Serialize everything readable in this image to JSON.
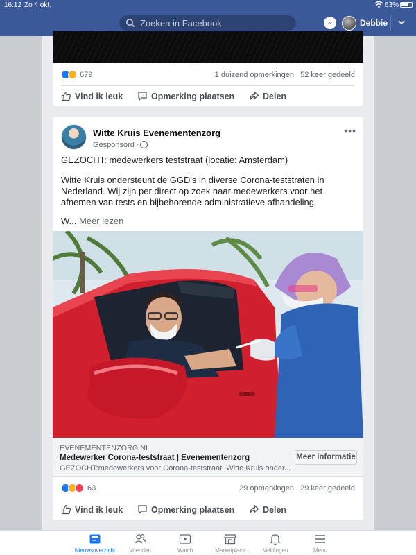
{
  "status_bar": {
    "time": "16:12",
    "date": "Zo 4 okt.",
    "battery": "63%"
  },
  "header": {
    "search_placeholder": "Zoeken in Facebook",
    "user_name": "Debbie"
  },
  "post_previous": {
    "reaction_count": "679",
    "comments": "1 duizend opmerkingen",
    "shares": "52 keer gedeeld",
    "actions": {
      "like": "Vind ik leuk",
      "comment": "Opmerking plaatsen",
      "share": "Delen"
    }
  },
  "post_ad": {
    "page_name": "Witte Kruis Evenementenzorg",
    "sponsored": "Gesponsord",
    "separator": "·",
    "headline": "GEZOCHT: medewerkers teststraat (locatie: Amsterdam)",
    "body": "Witte Kruis ondersteunt de GGD's in diverse Corona-teststraten in Nederland. Wij zijn per direct op zoek naar medewerkers voor het afnemen van tests en bijbehorende administratieve afhandeling.",
    "truncated": "W...",
    "read_more": "Meer lezen",
    "link": {
      "domain": "EVENEMENTENZORG.NL",
      "title": "Medewerker Corona-teststraat | Evenementenzorg",
      "description": "GEZOCHT:medewerkers voor Corona-teststraat. Witte Kruis onder...",
      "cta": "Meer informatie"
    },
    "reaction_count": "63",
    "comments": "29 opmerkingen",
    "shares": "29 keer gedeeld",
    "actions": {
      "like": "Vind ik leuk",
      "comment": "Opmerking plaatsen",
      "share": "Delen"
    }
  },
  "tabs": [
    {
      "label": "Nieuwsoverzicht",
      "icon": "news-feed-icon",
      "active": true
    },
    {
      "label": "Vrienden",
      "icon": "friends-icon",
      "active": false
    },
    {
      "label": "Watch",
      "icon": "watch-icon",
      "active": false
    },
    {
      "label": "Marketplace",
      "icon": "marketplace-icon",
      "active": false
    },
    {
      "label": "Meldingen",
      "icon": "bell-icon",
      "active": false
    },
    {
      "label": "Menu",
      "icon": "menu-icon",
      "active": false
    }
  ],
  "colors": {
    "brand": "#3b5998",
    "link_blue": "#1877f2",
    "background": "#e9ebee"
  }
}
